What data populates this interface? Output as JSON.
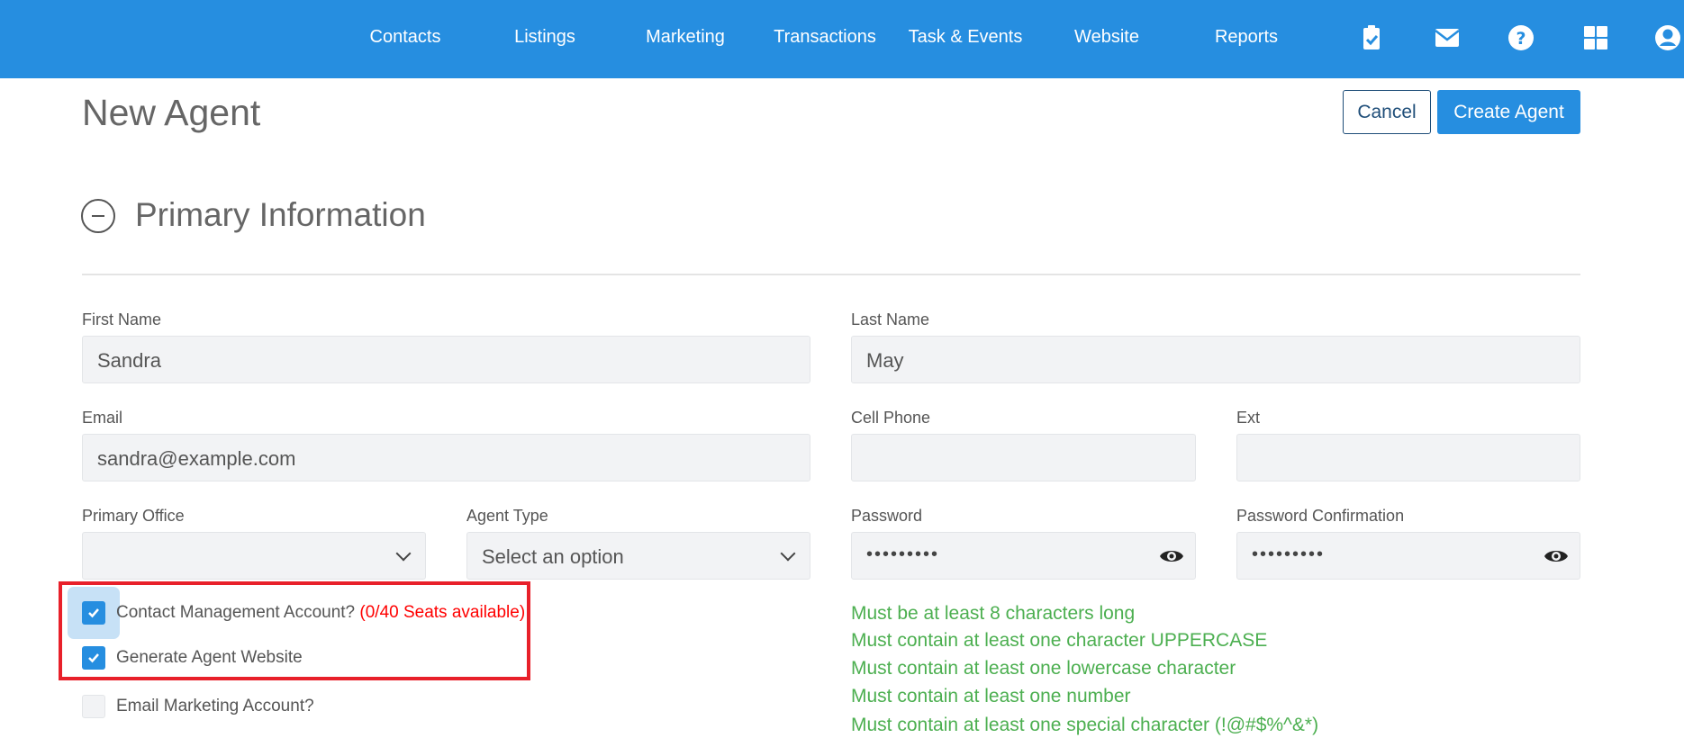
{
  "nav": {
    "items": [
      "Contacts",
      "Listings",
      "Marketing",
      "Transactions",
      "Task & Events",
      "Website",
      "Reports"
    ],
    "icons": [
      "clipboard-check-icon",
      "envelope-icon",
      "question-circle-icon",
      "grid-icon",
      "user-circle-icon"
    ]
  },
  "page": {
    "title": "New Agent",
    "cancel_label": "Cancel",
    "create_label": "Create Agent"
  },
  "section": {
    "title": "Primary Information"
  },
  "form": {
    "first_name": {
      "label": "First Name",
      "value": "Sandra"
    },
    "last_name": {
      "label": "Last Name",
      "value": "May"
    },
    "email": {
      "label": "Email",
      "value": "sandra@example.com"
    },
    "cell_phone": {
      "label": "Cell Phone",
      "value": ""
    },
    "ext": {
      "label": "Ext",
      "value": ""
    },
    "primary_office": {
      "label": "Primary Office",
      "value": ""
    },
    "agent_type": {
      "label": "Agent Type",
      "value": "Select an option"
    },
    "password": {
      "label": "Password",
      "value": "•••••••••"
    },
    "password_confirmation": {
      "label": "Password Confirmation",
      "value": "•••••••••"
    }
  },
  "checkboxes": [
    {
      "label": "Contact Management Account?",
      "note": "(0/40 Seats available)",
      "checked": true
    },
    {
      "label": "Generate Agent Website",
      "checked": true
    },
    {
      "label": "Email Marketing Account?",
      "checked": false
    }
  ],
  "password_rules": [
    "Must be at least 8 characters long",
    "Must contain at least one character UPPERCASE",
    "Must contain at least one lowercase character",
    "Must contain at least one number",
    "Must contain at least one special character (!@#$%^&*)"
  ],
  "colors": {
    "brand": "#268ee0",
    "rule_ok": "#4caf50",
    "highlight": "#e8202a"
  }
}
